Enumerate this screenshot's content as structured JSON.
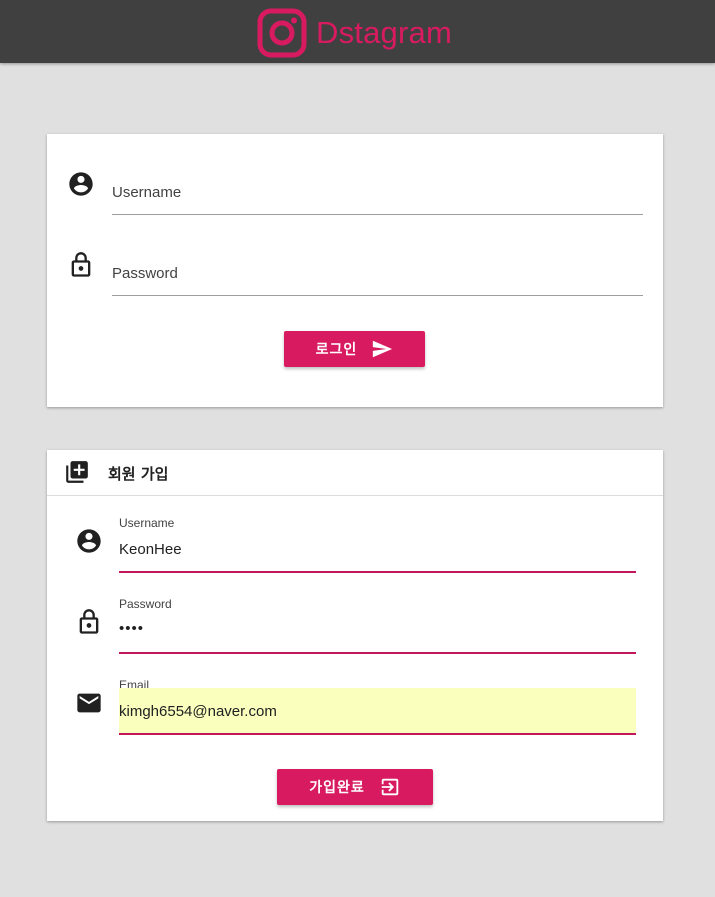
{
  "app": {
    "name": "Dstagram",
    "brand_color": "#d81b60"
  },
  "login": {
    "username_placeholder": "Username",
    "password_placeholder": "Password",
    "submit_label": "로그인",
    "submit_icon": "send-icon"
  },
  "signup": {
    "title": "회원 가입",
    "title_icon": "library-add-icon",
    "username": {
      "label": "Username",
      "value": "KeonHee"
    },
    "password": {
      "label": "Password",
      "value": "••••"
    },
    "email": {
      "label": "Email",
      "value": "kimgh6554@naver.com"
    },
    "submit_label": "가입완료",
    "submit_icon": "login-icon"
  },
  "colors": {
    "topbar": "#404040",
    "accent": "#d81b60",
    "field_underline_active": "#c2185b",
    "autofill_background": "#faffbd",
    "page_background": "#e0e0e0"
  }
}
